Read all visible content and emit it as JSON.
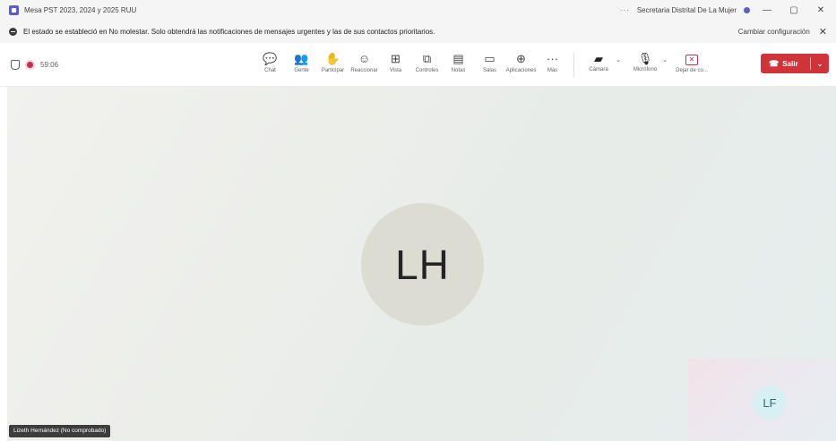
{
  "titlebar": {
    "title": "Mesa PST 2023, 2024 y 2025 RUU",
    "more": "···",
    "account": "Secretaria Distrital De La Mujer",
    "minimize": "—",
    "maximize": "▢",
    "close": "✕"
  },
  "notice": {
    "text": "El estado se estableció en No molestar. Solo obtendrá las notificaciones de mensajes urgentes y las de sus contactos prioritarios.",
    "action": "Cambiar configuración",
    "close": "✕"
  },
  "meeting": {
    "timer": "59:06"
  },
  "toolbar": {
    "tools": [
      {
        "label": "Chat",
        "icon": "chat-icon",
        "glyph": "💬"
      },
      {
        "label": "Gente",
        "icon": "people-icon",
        "glyph": "👥"
      },
      {
        "label": "Participar",
        "icon": "raise-hand-icon",
        "glyph": "✋"
      },
      {
        "label": "Reaccionar",
        "icon": "reaction-icon",
        "glyph": "☺"
      },
      {
        "label": "Vista",
        "icon": "view-icon",
        "glyph": "⊞"
      },
      {
        "label": "Controles",
        "icon": "controls-icon",
        "glyph": "⧉"
      },
      {
        "label": "Notas",
        "icon": "notes-icon",
        "glyph": "▤"
      },
      {
        "label": "Salas",
        "icon": "rooms-icon",
        "glyph": "▭"
      },
      {
        "label": "Aplicaciones",
        "icon": "apps-icon",
        "glyph": "⊕"
      },
      {
        "label": "Más",
        "icon": "more-icon",
        "glyph": "···"
      }
    ],
    "camera_label": "Cámara",
    "mic_label": "Micrófono",
    "share_label": "Dejar de co...",
    "leave_label": "Salir"
  },
  "stage": {
    "main_initials": "LH",
    "self_initials": "LF",
    "name_tag": "Lizeth Hernández (No comprobado)"
  }
}
